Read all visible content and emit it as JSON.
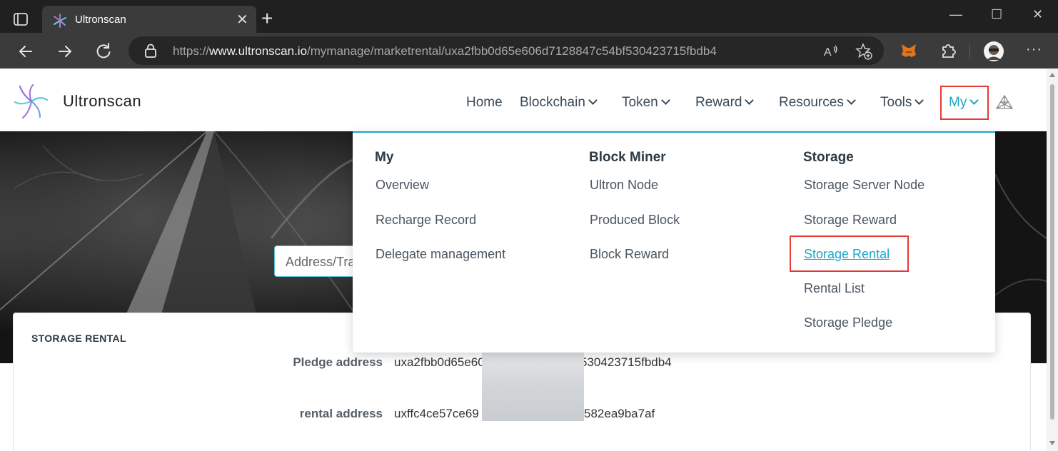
{
  "browser": {
    "tab_title": "Ultronscan",
    "url_prefix": "https://",
    "url_host": "www.ultronscan.io",
    "url_path": "/mymanage/marketrental/uxa2fbb0d65e606d7128847c54bf530423715fbdb4",
    "close_tab_glyph": "✕",
    "new_tab_glyph": "+",
    "minimize_glyph": "—",
    "maximize_glyph": "☐",
    "close_window_glyph": "✕",
    "more_glyph": "···"
  },
  "site": {
    "brand": "Ultronscan",
    "accent_color": "#1aa8c7",
    "nav": [
      {
        "label": "Home"
      },
      {
        "label": "Blockchain"
      },
      {
        "label": "Token"
      },
      {
        "label": "Reward"
      },
      {
        "label": "Resources"
      },
      {
        "label": "Tools"
      },
      {
        "label": "My"
      }
    ]
  },
  "hero": {
    "search_placeholder": "Address/Tra"
  },
  "dropdown": {
    "columns": [
      {
        "heading": "My",
        "items": [
          "Overview",
          "Recharge Record",
          "Delegate management"
        ]
      },
      {
        "heading": "Block Miner",
        "items": [
          "Ultron Node",
          "Produced Block",
          "Block Reward"
        ]
      },
      {
        "heading": "Storage",
        "items": [
          "Storage Server Node",
          "Storage Reward",
          "Storage Rental",
          "Rental List",
          "Storage Pledge"
        ]
      }
    ],
    "active_item": "Storage Rental"
  },
  "content": {
    "title": "STORAGE RENTAL",
    "rows": [
      {
        "label": "Pledge address",
        "value_start": "uxa2fbb0d65e60",
        "value_end": "530423715fbdb4"
      },
      {
        "label": "rental address",
        "value_start": "uxffc4ce57ce69",
        "value_end": "582ea9ba7af"
      }
    ]
  }
}
